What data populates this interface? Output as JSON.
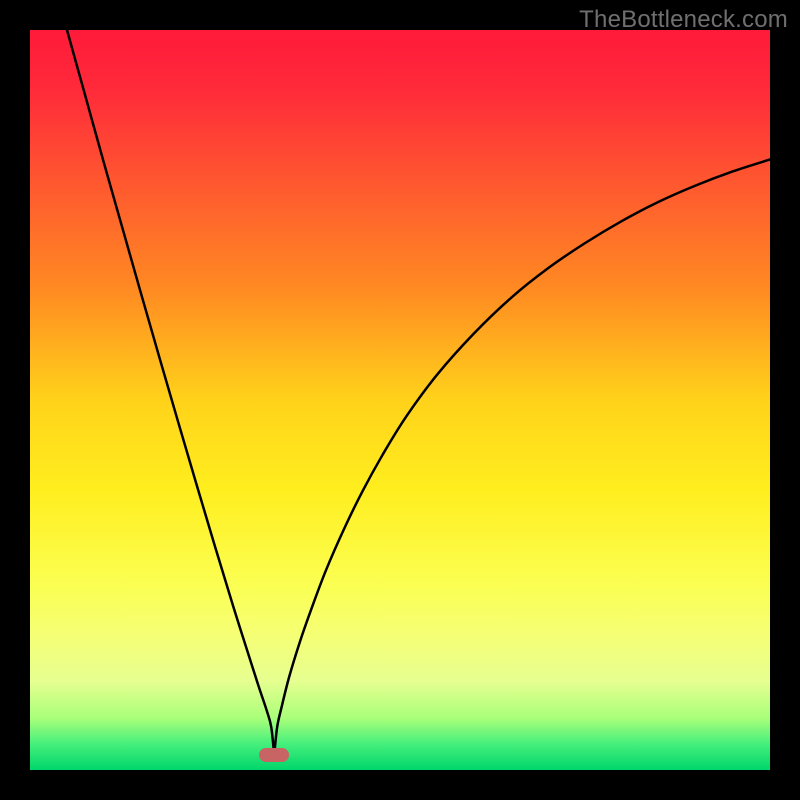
{
  "watermark": "TheBottleneck.com",
  "chart_data": {
    "type": "line",
    "title": "",
    "xlabel": "",
    "ylabel": "",
    "x_range": [
      0,
      100
    ],
    "y_range": [
      0,
      100
    ],
    "grid": false,
    "legend": false,
    "min_point_x": 33,
    "series": [
      {
        "name": "left-branch",
        "x": [
          5,
          7.5,
          10,
          12.5,
          15,
          17.5,
          20,
          22.5,
          25,
          27.5,
          30,
          31,
          32,
          32.6,
          33
        ],
        "y": [
          100,
          91,
          82,
          73.2,
          64.4,
          55.7,
          47.1,
          38.6,
          30.2,
          22,
          14.1,
          11,
          8,
          5.8,
          2
        ]
      },
      {
        "name": "right-branch",
        "x": [
          33,
          33.4,
          34,
          35,
          36.5,
          38,
          40,
          42.5,
          45,
          48,
          51,
          55,
          60,
          65,
          70,
          75,
          80,
          85,
          90,
          95,
          100
        ],
        "y": [
          2,
          5.8,
          8.5,
          12.5,
          17.4,
          21.7,
          27,
          32.7,
          37.8,
          43.2,
          48,
          53.4,
          59,
          63.8,
          67.8,
          71.2,
          74.2,
          76.8,
          79,
          80.9,
          82.5
        ]
      }
    ],
    "marker": {
      "x": 33,
      "y": 2,
      "color": "#c86464"
    },
    "gradient_stops": [
      {
        "pos": 0.0,
        "color": "#ff1a3a"
      },
      {
        "pos": 0.08,
        "color": "#ff2a3a"
      },
      {
        "pos": 0.2,
        "color": "#ff5530"
      },
      {
        "pos": 0.35,
        "color": "#ff8a22"
      },
      {
        "pos": 0.5,
        "color": "#ffd21a"
      },
      {
        "pos": 0.62,
        "color": "#ffee1e"
      },
      {
        "pos": 0.75,
        "color": "#fbff52"
      },
      {
        "pos": 0.82,
        "color": "#f5ff76"
      },
      {
        "pos": 0.88,
        "color": "#e6ff90"
      },
      {
        "pos": 0.93,
        "color": "#a9ff7a"
      },
      {
        "pos": 0.965,
        "color": "#45ef7c"
      },
      {
        "pos": 1.0,
        "color": "#00d66b"
      }
    ]
  }
}
